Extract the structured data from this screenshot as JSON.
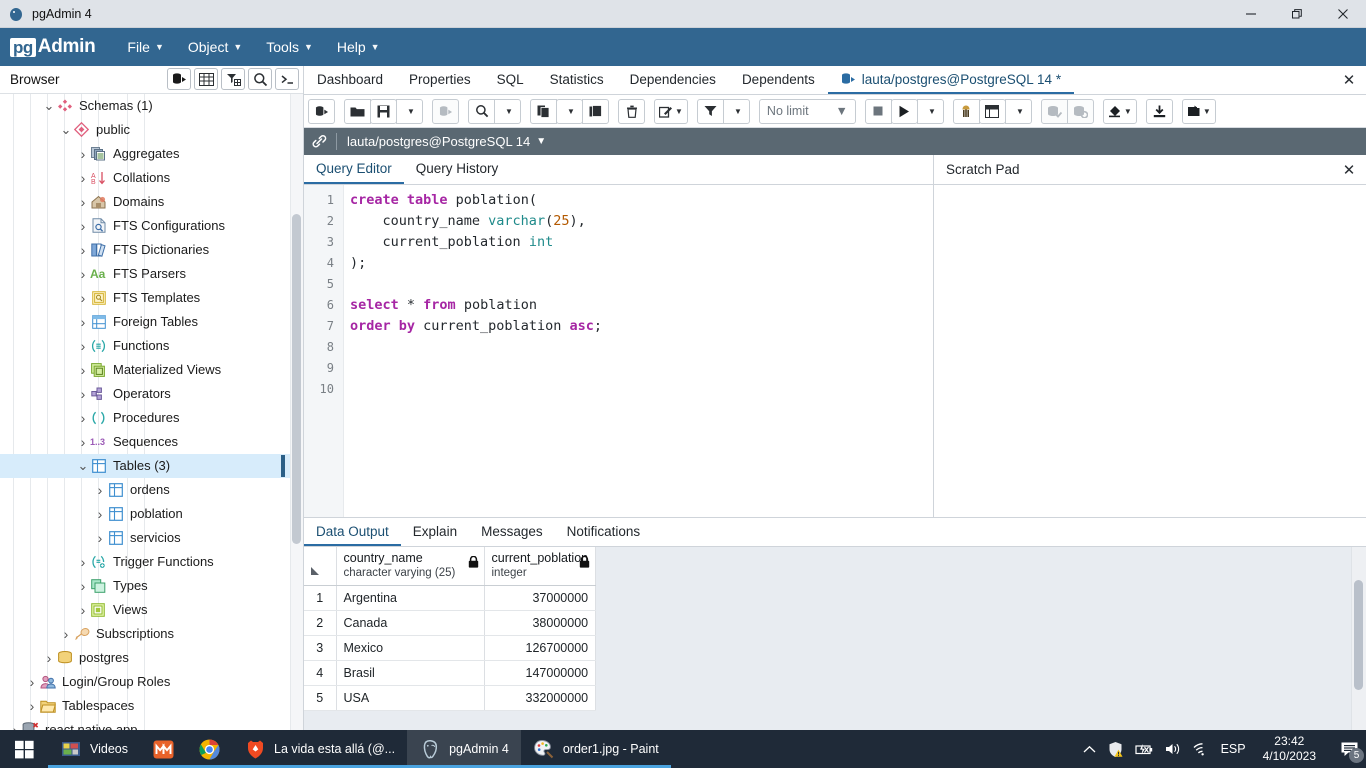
{
  "window": {
    "title": "pgAdmin 4",
    "app_icon": "postgres-elephant-icon",
    "minimize": "minimize-icon",
    "maximize": "restore-icon",
    "close": "close-icon"
  },
  "menubar": {
    "brand_pg": "pg",
    "brand_admin": "Admin",
    "items": [
      {
        "label": "File"
      },
      {
        "label": "Object"
      },
      {
        "label": "Tools"
      },
      {
        "label": "Help"
      }
    ]
  },
  "browser": {
    "title": "Browser",
    "tools": [
      {
        "name": "object-explorer-icon"
      },
      {
        "name": "grid-view-icon"
      },
      {
        "name": "filter-table-icon"
      },
      {
        "name": "search-icon"
      },
      {
        "name": "terminal-icon"
      }
    ],
    "tree": [
      {
        "label": "Schemas (1)",
        "indent": 2,
        "state": "open",
        "icon": "schemas-icon"
      },
      {
        "label": "public",
        "indent": 3,
        "state": "open",
        "icon": "schema-icon"
      },
      {
        "label": "Aggregates",
        "indent": 4,
        "state": "closed",
        "icon": "aggregates-icon"
      },
      {
        "label": "Collations",
        "indent": 4,
        "state": "closed",
        "icon": "collations-icon"
      },
      {
        "label": "Domains",
        "indent": 4,
        "state": "closed",
        "icon": "domains-icon"
      },
      {
        "label": "FTS Configurations",
        "indent": 4,
        "state": "closed",
        "icon": "fts-configurations-icon"
      },
      {
        "label": "FTS Dictionaries",
        "indent": 4,
        "state": "closed",
        "icon": "fts-dictionaries-icon"
      },
      {
        "label": "FTS Parsers",
        "indent": 4,
        "state": "closed",
        "icon": "fts-parsers-icon"
      },
      {
        "label": "FTS Templates",
        "indent": 4,
        "state": "closed",
        "icon": "fts-templates-icon"
      },
      {
        "label": "Foreign Tables",
        "indent": 4,
        "state": "closed",
        "icon": "foreign-tables-icon"
      },
      {
        "label": "Functions",
        "indent": 4,
        "state": "closed",
        "icon": "functions-icon"
      },
      {
        "label": "Materialized Views",
        "indent": 4,
        "state": "closed",
        "icon": "materialized-views-icon"
      },
      {
        "label": "Operators",
        "indent": 4,
        "state": "closed",
        "icon": "operators-icon"
      },
      {
        "label": "Procedures",
        "indent": 4,
        "state": "closed",
        "icon": "procedures-icon"
      },
      {
        "label": "Sequences",
        "indent": 4,
        "state": "closed",
        "icon": "sequences-icon"
      },
      {
        "label": "Tables (3)",
        "indent": 4,
        "state": "open",
        "icon": "tables-icon",
        "selected": true
      },
      {
        "label": "ordens",
        "indent": 5,
        "state": "closed",
        "icon": "table-icon"
      },
      {
        "label": "poblation",
        "indent": 5,
        "state": "closed",
        "icon": "table-icon"
      },
      {
        "label": "servicios",
        "indent": 5,
        "state": "closed",
        "icon": "table-icon"
      },
      {
        "label": "Trigger Functions",
        "indent": 4,
        "state": "closed",
        "icon": "trigger-functions-icon"
      },
      {
        "label": "Types",
        "indent": 4,
        "state": "closed",
        "icon": "types-icon"
      },
      {
        "label": "Views",
        "indent": 4,
        "state": "closed",
        "icon": "views-icon"
      },
      {
        "label": "Subscriptions",
        "indent": 3,
        "state": "closed",
        "icon": "subscriptions-icon"
      },
      {
        "label": "postgres",
        "indent": 2,
        "state": "closed",
        "icon": "database-icon"
      },
      {
        "label": "Login/Group Roles",
        "indent": 1,
        "state": "closed",
        "icon": "roles-icon"
      },
      {
        "label": "Tablespaces",
        "indent": 1,
        "state": "closed",
        "icon": "tablespaces-icon"
      },
      {
        "label": "react native app",
        "indent": 0,
        "state": "closed",
        "icon": "server-disconnected-icon"
      }
    ]
  },
  "object_tabs": {
    "items": [
      {
        "label": "Dashboard",
        "active": false
      },
      {
        "label": "Properties",
        "active": false
      },
      {
        "label": "SQL",
        "active": false
      },
      {
        "label": "Statistics",
        "active": false
      },
      {
        "label": "Dependencies",
        "active": false
      },
      {
        "label": "Dependents",
        "active": false
      },
      {
        "label": "lauta/postgres@PostgreSQL 14 *",
        "active": true,
        "icon": "query-tool-icon"
      }
    ],
    "close_label": "✕"
  },
  "query_toolbar": {
    "buttons": [
      {
        "name": "open-query-tool-icon",
        "group": 0,
        "disabled": false
      },
      {
        "name": "open-file-icon",
        "group": 1,
        "disabled": false
      },
      {
        "name": "save-file-icon",
        "group": 1,
        "disabled": false
      },
      {
        "name": "save-dropdown-icon",
        "group": 1,
        "disabled": false
      },
      {
        "name": "edit-data-icon",
        "group": 2,
        "disabled": true
      },
      {
        "name": "find-icon",
        "group": 3,
        "disabled": false
      },
      {
        "name": "find-dropdown-icon",
        "group": 3,
        "disabled": false
      },
      {
        "name": "copy-icon",
        "group": 4,
        "disabled": false
      },
      {
        "name": "copy-dropdown-icon",
        "group": 4,
        "disabled": false
      },
      {
        "name": "paste-icon",
        "group": 4,
        "disabled": false
      },
      {
        "name": "delete-row-icon",
        "group": 5,
        "disabled": false
      },
      {
        "name": "edit-icon",
        "group": 6,
        "disabled": false
      },
      {
        "name": "filter-icon",
        "group": 7,
        "disabled": false
      },
      {
        "name": "filter-dropdown-icon",
        "group": 7,
        "disabled": false
      }
    ],
    "limit_value": "No limit",
    "right_buttons": [
      {
        "name": "stop-icon"
      },
      {
        "name": "execute-play-icon"
      },
      {
        "name": "execute-dropdown-icon"
      },
      {
        "name": "explain-icon"
      },
      {
        "name": "explain-analyze-icon"
      },
      {
        "name": "explain-options-dropdown-icon"
      },
      {
        "name": "commit-icon"
      },
      {
        "name": "rollback-icon"
      },
      {
        "name": "clear-icon"
      },
      {
        "name": "download-csv-icon"
      },
      {
        "name": "macros-icon"
      }
    ]
  },
  "connection": {
    "icon": "connection-link-icon",
    "label": "lauta/postgres@PostgreSQL 14",
    "caret": "⌄"
  },
  "editor": {
    "tabs": [
      {
        "label": "Query Editor",
        "active": true
      },
      {
        "label": "Query History",
        "active": false
      }
    ],
    "line_numbers": [
      "1",
      "2",
      "3",
      "4",
      "5",
      "6",
      "7",
      "8",
      "9",
      "10"
    ],
    "sql_lines": [
      [
        {
          "t": "create table ",
          "c": "kw"
        },
        {
          "t": "poblation(",
          "c": "pl"
        }
      ],
      [
        {
          "t": "    country_name ",
          "c": "pl"
        },
        {
          "t": "varchar",
          "c": "ty"
        },
        {
          "t": "(",
          "c": "pl"
        },
        {
          "t": "25",
          "c": "num"
        },
        {
          "t": "),",
          "c": "pl"
        }
      ],
      [
        {
          "t": "    current_poblation ",
          "c": "pl"
        },
        {
          "t": "int",
          "c": "ty"
        }
      ],
      [
        {
          "t": ");",
          "c": "pl"
        }
      ],
      [],
      [
        {
          "t": "select ",
          "c": "kw"
        },
        {
          "t": "* ",
          "c": "pl"
        },
        {
          "t": "from ",
          "c": "kw"
        },
        {
          "t": "poblation",
          "c": "pl"
        }
      ],
      [
        {
          "t": "order by ",
          "c": "kw"
        },
        {
          "t": "current_poblation ",
          "c": "pl"
        },
        {
          "t": "asc",
          "c": "kw"
        },
        {
          "t": ";",
          "c": "pl"
        }
      ],
      [],
      [],
      []
    ]
  },
  "scratch_pad": {
    "title": "Scratch Pad",
    "close": "✕"
  },
  "output": {
    "tabs": [
      {
        "label": "Data Output",
        "active": true
      },
      {
        "label": "Explain",
        "active": false
      },
      {
        "label": "Messages",
        "active": false
      },
      {
        "label": "Notifications",
        "active": false
      }
    ],
    "columns": [
      {
        "name": "country_name",
        "type": "character varying (25)",
        "lock": "lock-icon",
        "width": 148
      },
      {
        "name": "current_poblation",
        "type": "integer",
        "lock": "lock-icon",
        "width": 108
      }
    ],
    "rows": [
      {
        "num": "1",
        "country_name": "Argentina",
        "current_poblation": "37000000"
      },
      {
        "num": "2",
        "country_name": "Canada",
        "current_poblation": "38000000"
      },
      {
        "num": "3",
        "country_name": "Mexico",
        "current_poblation": "126700000"
      },
      {
        "num": "4",
        "country_name": "Brasil",
        "current_poblation": "147000000"
      },
      {
        "num": "5",
        "country_name": "USA",
        "current_poblation": "332000000"
      }
    ]
  },
  "taskbar": {
    "start": "windows-start-icon",
    "apps": [
      {
        "label": "Videos",
        "icon": "videos-folder-icon",
        "active": false,
        "running": true
      },
      {
        "label": "",
        "icon": "mendeley-icon",
        "active": false,
        "running": true
      },
      {
        "label": "",
        "icon": "chrome-icon",
        "active": false,
        "running": true
      },
      {
        "label": "La vida esta allá (@...",
        "icon": "brave-icon",
        "active": false,
        "running": true
      },
      {
        "label": "pgAdmin 4",
        "icon": "postgres-elephant-icon",
        "active": true,
        "running": true
      },
      {
        "label": "order1.jpg - Paint",
        "icon": "paint-icon",
        "active": false,
        "running": true
      }
    ],
    "tray": [
      {
        "name": "show-hidden-icons-chevron"
      },
      {
        "name": "security-warning-icon"
      },
      {
        "name": "battery-icon"
      },
      {
        "name": "volume-icon"
      },
      {
        "name": "wifi-icon"
      }
    ],
    "language": "ESP",
    "time": "23:42",
    "date": "4/10/2023",
    "notification_icon": "notifications-icon",
    "notification_count": "5"
  },
  "colors": {
    "brand_blue": "#326690",
    "connbar_gray": "#5a6872",
    "tab_accent": "#2b6ca3",
    "selection": "#d7ecfb",
    "taskbar": "#1f2a38",
    "keyword": "#a626a4",
    "type": "#1f8a8a",
    "number": "#b35900"
  }
}
